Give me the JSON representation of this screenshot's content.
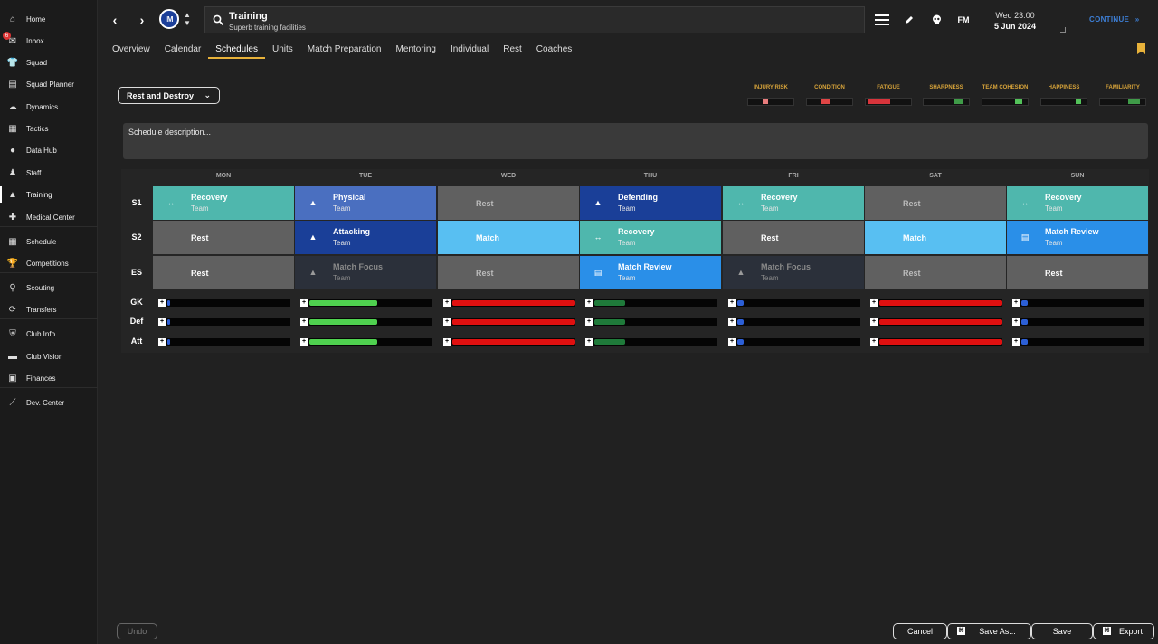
{
  "sidebar": {
    "items": [
      {
        "label": "Home",
        "icon": "home-icon",
        "glyph": "⌂"
      },
      {
        "label": "Inbox",
        "icon": "inbox-icon",
        "glyph": "✉",
        "badge": "6"
      },
      {
        "label": "Squad",
        "icon": "shirt-icon",
        "glyph": "👕"
      },
      {
        "label": "Squad Planner",
        "icon": "clipboard-icon",
        "glyph": "▤"
      },
      {
        "label": "Dynamics",
        "icon": "dynamics-icon",
        "glyph": "☁"
      },
      {
        "label": "Tactics",
        "icon": "tactics-icon",
        "glyph": "▦"
      },
      {
        "label": "Data Hub",
        "icon": "data-hub-icon",
        "glyph": "●"
      },
      {
        "label": "Staff",
        "icon": "staff-icon",
        "glyph": "♟"
      },
      {
        "label": "Training",
        "icon": "cone-icon",
        "glyph": "▲"
      },
      {
        "label": "Medical Center",
        "icon": "medical-icon",
        "glyph": "✚"
      },
      {
        "label": "Schedule",
        "icon": "calendar-icon",
        "glyph": "▦"
      },
      {
        "label": "Competitions",
        "icon": "trophy-icon",
        "glyph": "🏆"
      },
      {
        "label": "Scouting",
        "icon": "scouting-icon",
        "glyph": "⚲"
      },
      {
        "label": "Transfers",
        "icon": "transfers-icon",
        "glyph": "⟳"
      },
      {
        "label": "Club Info",
        "icon": "shield-icon",
        "glyph": "⛨"
      },
      {
        "label": "Club Vision",
        "icon": "vision-icon",
        "glyph": "▬"
      },
      {
        "label": "Finances",
        "icon": "finances-icon",
        "glyph": "▣"
      },
      {
        "label": "Dev. Center",
        "icon": "dev-center-icon",
        "glyph": "⟋"
      }
    ]
  },
  "header": {
    "title": "Training",
    "subtitle": "Superb training facilities",
    "club_abbr": "IM",
    "time": "Wed 23:00",
    "date": "5 Jun 2024",
    "continue_label": "CONTINUE",
    "fm_label": "FM"
  },
  "tabs": [
    "Overview",
    "Calendar",
    "Schedules",
    "Units",
    "Match Preparation",
    "Mentoring",
    "Individual",
    "Rest",
    "Coaches"
  ],
  "active_tab": "Schedules",
  "schedule_name": "Rest and Destroy",
  "meters": [
    {
      "label": "INJURY RISK",
      "color": "#e87d7d",
      "level": 0.2
    },
    {
      "label": "CONDITION",
      "color": "#e04545",
      "level": 0.35
    },
    {
      "label": "FATIGUE",
      "color": "#d8343b",
      "level": 0.5
    },
    {
      "label": "SHARPNESS",
      "color": "#3f9b48",
      "level": 0.45
    },
    {
      "label": "TEAM COHESION",
      "color": "#53c25a",
      "level": 0.3
    },
    {
      "label": "HAPPINESS",
      "color": "#53c25a",
      "level": 0.2
    },
    {
      "label": "FAMILIARITY",
      "color": "#3f9b48",
      "level": 0.5
    }
  ],
  "description_placeholder": "Schedule description...",
  "days": [
    "MON",
    "TUE",
    "WED",
    "THU",
    "FRI",
    "SAT",
    "SUN"
  ],
  "sessions": [
    {
      "row": "S1",
      "cells": [
        {
          "name": "Recovery",
          "sub": "Team",
          "style": "teal",
          "icon": "recovery-icon"
        },
        {
          "name": "Physical",
          "sub": "Team",
          "style": "blue",
          "icon": "cone-icon"
        },
        {
          "name": "Rest",
          "sub": "",
          "style": "grey",
          "icon": ""
        },
        {
          "name": "Defending",
          "sub": "Team",
          "style": "darkblue",
          "icon": "cone-icon"
        },
        {
          "name": "Recovery",
          "sub": "Team",
          "style": "teal",
          "icon": "recovery-icon"
        },
        {
          "name": "Rest",
          "sub": "",
          "style": "grey",
          "icon": ""
        },
        {
          "name": "Recovery",
          "sub": "Team",
          "style": "teal",
          "icon": "recovery-icon"
        }
      ]
    },
    {
      "row": "S2",
      "cells": [
        {
          "name": "Rest",
          "sub": "",
          "style": "grey-bright",
          "icon": ""
        },
        {
          "name": "Attacking",
          "sub": "Team",
          "style": "darkblue",
          "icon": "cone-icon"
        },
        {
          "name": "Match",
          "sub": "",
          "style": "lightblue",
          "icon": ""
        },
        {
          "name": "Recovery",
          "sub": "Team",
          "style": "teal",
          "icon": "recovery-icon"
        },
        {
          "name": "Rest",
          "sub": "",
          "style": "grey-bright",
          "icon": ""
        },
        {
          "name": "Match",
          "sub": "",
          "style": "lightblue",
          "icon": ""
        },
        {
          "name": "Match Review",
          "sub": "Team",
          "style": "brightblue",
          "icon": "document-icon"
        }
      ]
    },
    {
      "row": "ES",
      "cells": [
        {
          "name": "Rest",
          "sub": "",
          "style": "grey-bright",
          "icon": ""
        },
        {
          "name": "Match Focus",
          "sub": "Team",
          "style": "dark",
          "icon": "cone-icon"
        },
        {
          "name": "Rest",
          "sub": "",
          "style": "grey",
          "icon": ""
        },
        {
          "name": "Match Review",
          "sub": "Team",
          "style": "brightblue",
          "icon": "document-icon"
        },
        {
          "name": "Match Focus",
          "sub": "Team",
          "style": "dark",
          "icon": "cone-icon"
        },
        {
          "name": "Rest",
          "sub": "",
          "style": "grey",
          "icon": ""
        },
        {
          "name": "Rest",
          "sub": "",
          "style": "grey-bright",
          "icon": ""
        }
      ]
    }
  ],
  "load_rows": [
    "GK",
    "Def",
    "Att"
  ],
  "load_days": [
    {
      "level": 0.0,
      "color": "#2c5fd6"
    },
    {
      "level": 0.55,
      "color": "#4fd14f"
    },
    {
      "level": 1.0,
      "color": "#e01010"
    },
    {
      "level": 0.25,
      "color": "#1f7a3a"
    },
    {
      "level": 0.05,
      "color": "#2c5fd6"
    },
    {
      "level": 1.0,
      "color": "#e01010"
    },
    {
      "level": 0.05,
      "color": "#2c5fd6"
    }
  ],
  "buttons": {
    "undo": "Undo",
    "cancel": "Cancel",
    "save_as": "Save As...",
    "save": "Save",
    "export": "Export"
  }
}
